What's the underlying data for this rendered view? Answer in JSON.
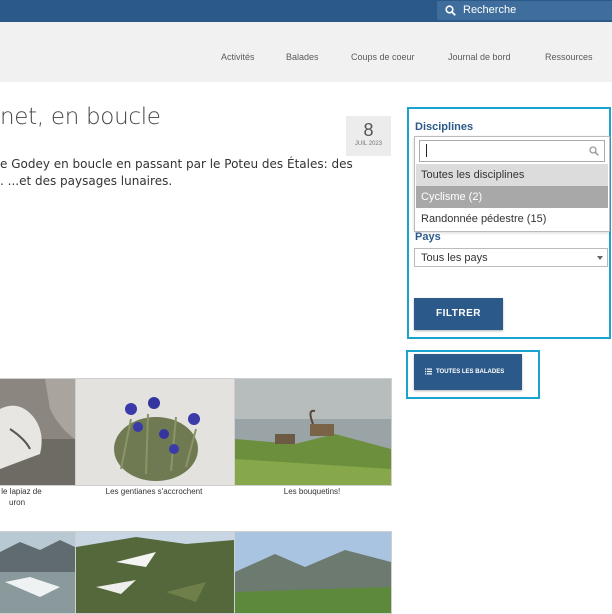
{
  "search": {
    "label": "Recherche",
    "icon": "search-icon"
  },
  "nav": [
    "Activités",
    "Balades",
    "Coups de coeur",
    "Journal de bord",
    "Ressources"
  ],
  "post": {
    "title": "net, en boucle",
    "intro_line1": "e Godey en boucle en passant par le Poteu des Étales: des",
    "intro_line2": ". ...et des paysages lunaires.",
    "date_day": "8",
    "date_month": "JUIL 2023"
  },
  "filters": {
    "disciplines_label": "Disciplines",
    "discipline_options": [
      "Toutes les disciplines",
      "Cyclisme (2)",
      "Randonnée pédestre (15)"
    ],
    "pays_label": "Pays",
    "pays_value": "Tous les pays",
    "submit_label": "FILTRER"
  },
  "all_balades_label": "TOUTES LES BALADES",
  "gallery": {
    "captions": [
      "s le lapiaz de",
      "uron",
      "Les gentianes s'accrochent",
      "Les bouquetins!"
    ]
  },
  "colors": {
    "topbar": "#2b5a8a",
    "accent": "#19a3cf",
    "button": "#2b5a8a"
  }
}
